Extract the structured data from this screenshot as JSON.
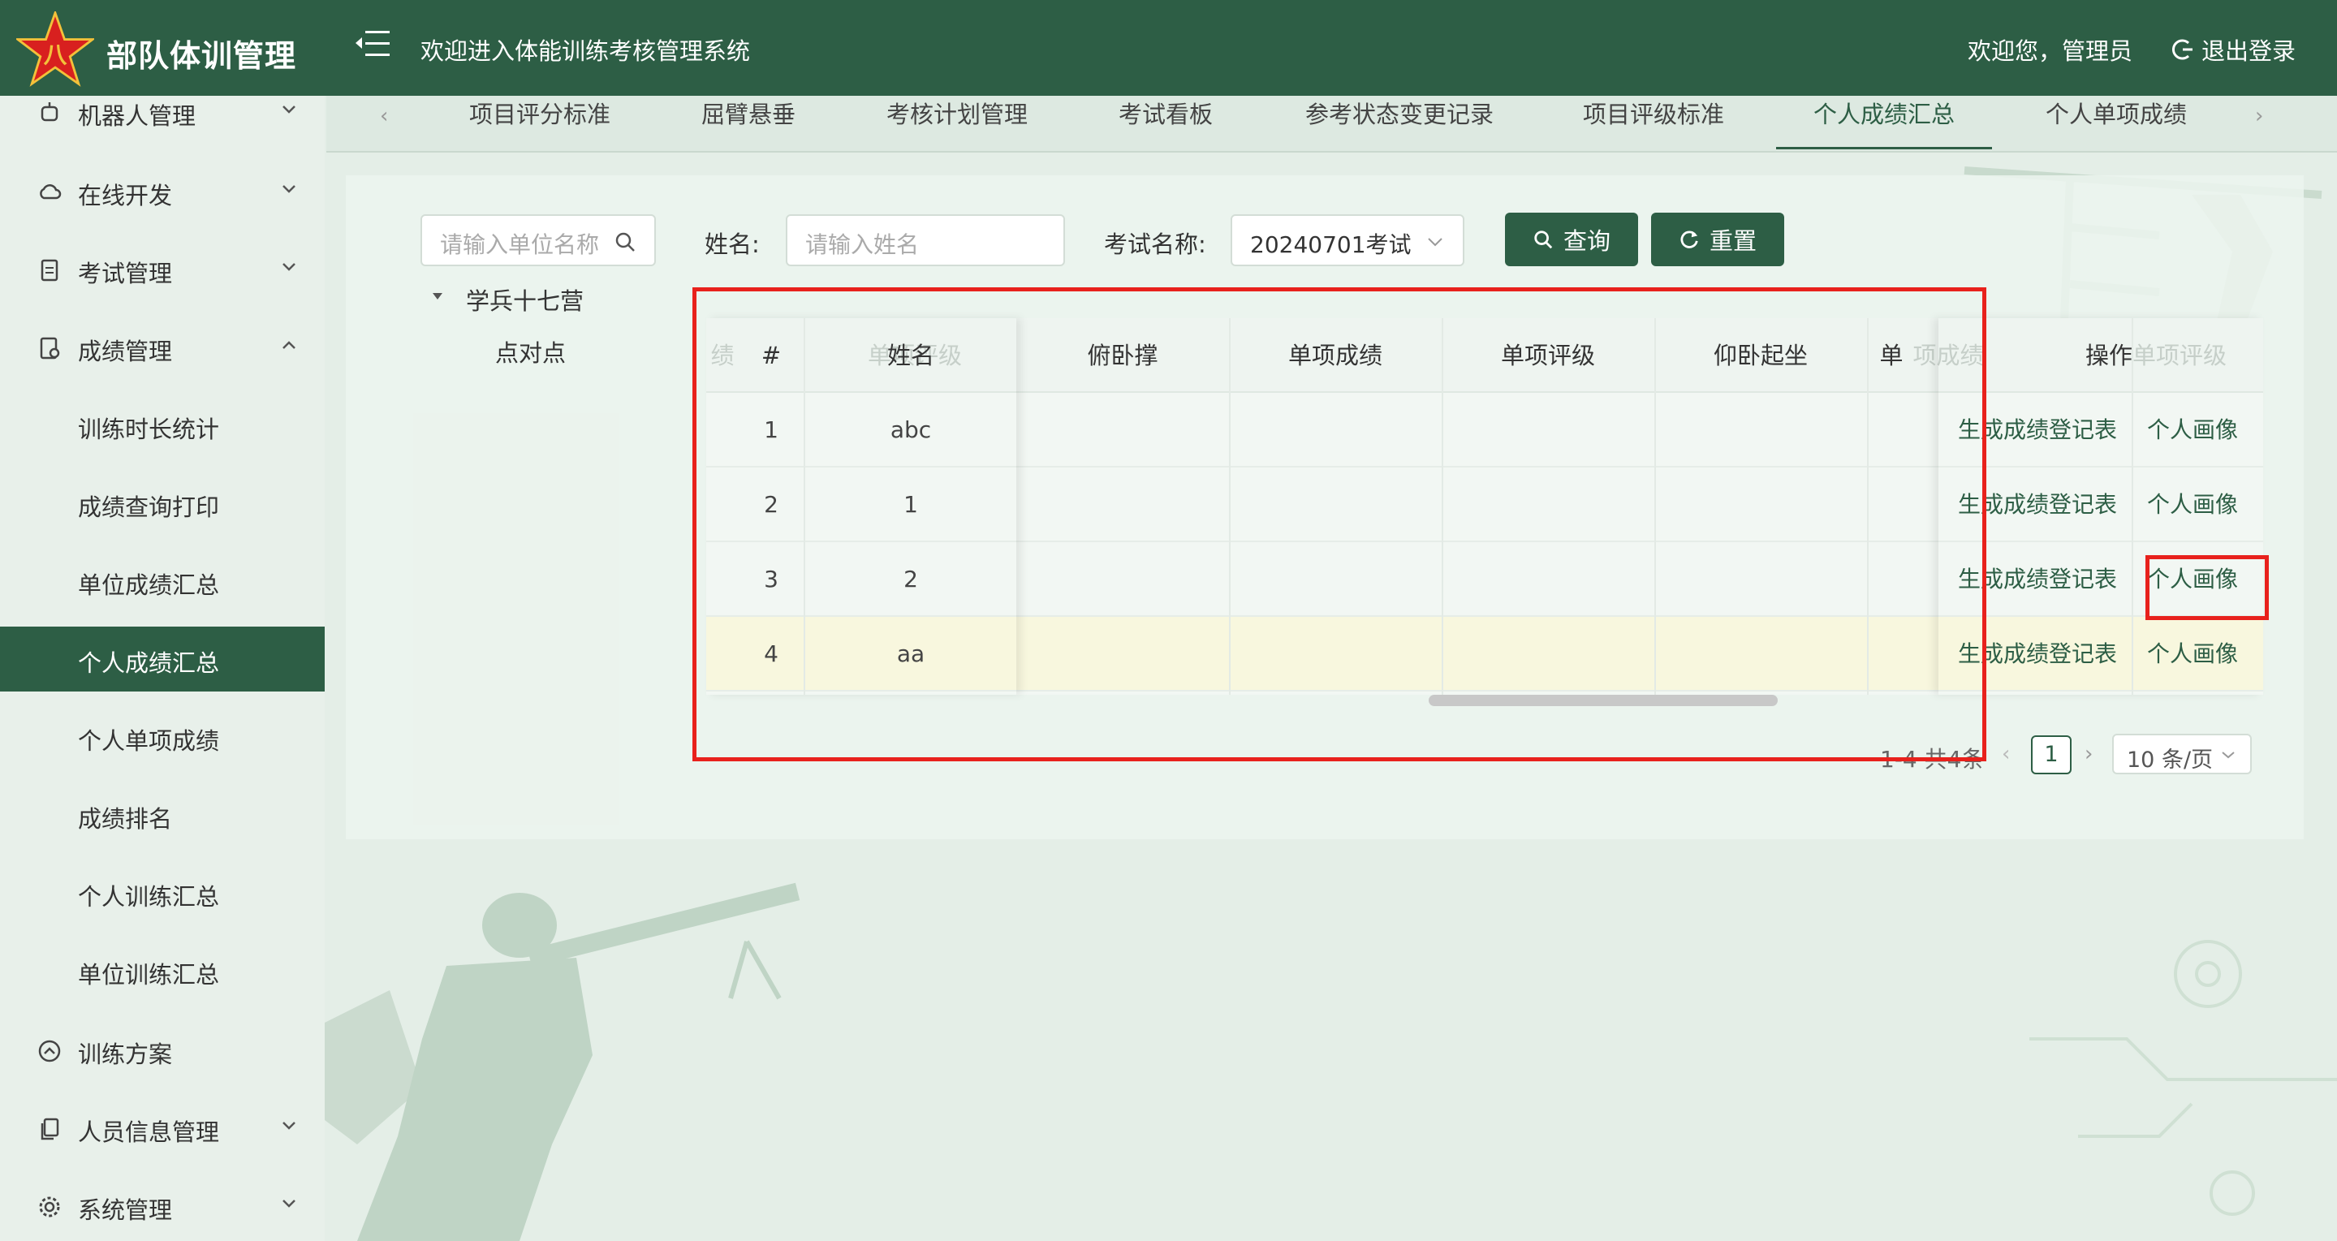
{
  "header": {
    "app_title": "部队体训管理",
    "system_welcome": "欢迎进入体能训练考核管理系统",
    "user_welcome": "欢迎您，管理员",
    "logout_label": "退出登录",
    "brand_color": "#2d5e45"
  },
  "sidebar": {
    "items": [
      {
        "label": "机器人管理",
        "icon": "robot-icon",
        "expanded": false
      },
      {
        "label": "在线开发",
        "icon": "cloud-icon",
        "expanded": false
      },
      {
        "label": "考试管理",
        "icon": "document-icon",
        "expanded": false
      },
      {
        "label": "成绩管理",
        "icon": "score-doc-icon",
        "expanded": true
      },
      {
        "label": "训练方案",
        "icon": "circle-up-icon"
      },
      {
        "label": "人员信息管理",
        "icon": "copy-icon",
        "expanded": false
      },
      {
        "label": "系统管理",
        "icon": "gear-icon",
        "expanded": false
      }
    ],
    "sub_items": [
      {
        "label": "训练时长统计"
      },
      {
        "label": "成绩查询打印"
      },
      {
        "label": "单位成绩汇总"
      },
      {
        "label": "个人成绩汇总",
        "active": true
      },
      {
        "label": "个人单项成绩"
      },
      {
        "label": "成绩排名"
      },
      {
        "label": "个人训练汇总"
      },
      {
        "label": "单位训练汇总"
      }
    ]
  },
  "tabs": [
    {
      "label": "项目评分标准"
    },
    {
      "label": "屈臂悬垂"
    },
    {
      "label": "考核计划管理"
    },
    {
      "label": "考试看板"
    },
    {
      "label": "参考状态变更记录"
    },
    {
      "label": "项目评级标准"
    },
    {
      "label": "个人成绩汇总",
      "active": true
    },
    {
      "label": "个人单项成绩"
    }
  ],
  "filters": {
    "unit_search_placeholder": "请输入单位名称",
    "name_label": "姓名:",
    "name_placeholder": "请输入姓名",
    "exam_label": "考试名称:",
    "exam_value": "20240701考试",
    "query_label": "查询",
    "reset_label": "重置"
  },
  "tree": {
    "node": "学兵十七营",
    "child": "点对点"
  },
  "table": {
    "ghost_left_headers": [
      "绩",
      "单项评级"
    ],
    "headers": [
      "#",
      "姓名",
      "俯卧撑",
      "单项成绩",
      "单项评级",
      "仰卧起坐",
      "单",
      "操作"
    ],
    "ghost_right_headers": [
      "项成绩",
      "单项评级"
    ],
    "rows": [
      {
        "index": "1",
        "name": "abc"
      },
      {
        "index": "2",
        "name": "1"
      },
      {
        "index": "3",
        "name": "2"
      },
      {
        "index": "4",
        "name": "aa"
      }
    ],
    "action_generate": "生成成绩登记表",
    "action_profile": "个人画像"
  },
  "pagination": {
    "total": "1-4 共4条",
    "current_page": "1",
    "page_size": "10 条/页"
  },
  "annotation_color": "#e8211c"
}
